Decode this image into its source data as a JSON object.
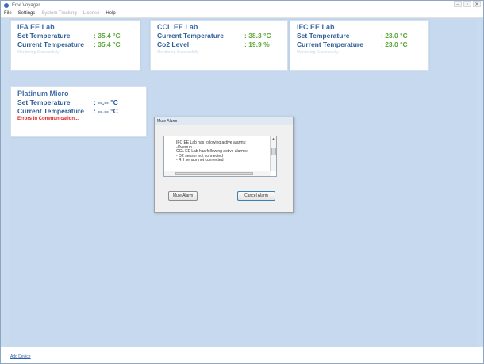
{
  "window": {
    "title": "Envi Voyager",
    "controls": [
      "–",
      "▫",
      "✕"
    ]
  },
  "menu": {
    "items": [
      "File",
      "Settings",
      "System Tracking",
      "License",
      "Help"
    ]
  },
  "cards": [
    {
      "title": "IFA EE Lab",
      "rows": [
        {
          "label": "Set Temperature",
          "value": ": 35.4 °C"
        },
        {
          "label": "Current Temperature",
          "value": ": 35.4 °C"
        }
      ],
      "footnote": "Monitoring Successfully"
    },
    {
      "title": "CCL EE Lab",
      "rows": [
        {
          "label": "Current Temperature",
          "value": ": 38.3 °C"
        },
        {
          "label": "Co2 Level",
          "value": ": 19.9 %"
        }
      ],
      "footnote": "Monitoring Successfully"
    },
    {
      "title": "IFC EE Lab",
      "rows": [
        {
          "label": "Set Temperature",
          "value": ": 23.0 °C"
        },
        {
          "label": "Current Temperature",
          "value": ": 23.0 °C"
        }
      ],
      "footnote": "Monitoring Successfully"
    },
    {
      "title": "Platinum Micro",
      "rows": [
        {
          "label": "Set Temperature",
          "value": ": --.-- °C"
        },
        {
          "label": "Current Temperature",
          "value": ": --.-- °C"
        }
      ],
      "footnote": "Errors in Communication..."
    }
  ],
  "dialog": {
    "title": "Mute Alarm",
    "messages": [
      "IFC EE Lab has following active alarms:",
      "-Overrun",
      "CCL EE Lab has following active alarms:",
      "- O2 sensor not connected",
      "- RH sensor not connected"
    ],
    "mute_label": "Mute Alarm",
    "cancel_label": "Cancel Alarm"
  },
  "status": {
    "link_label": "Add Device"
  },
  "colors": {
    "background": "#c6d9ee",
    "card_title": "#3d6aa8",
    "label": "#2e5c97",
    "value_ok": "#5aa637",
    "error": "#e22020"
  }
}
